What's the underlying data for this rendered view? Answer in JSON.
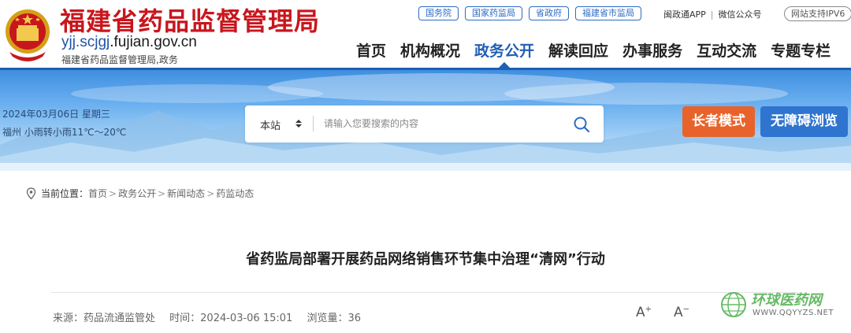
{
  "header": {
    "site_name": "福建省药品监督管理局",
    "domain_prefix": "yjj.scjgj",
    "domain_suffix": ".fujian.gov.cn",
    "subtitle": "福建省药品监督管理局,政务",
    "top_links": [
      "国务院",
      "国家药监局",
      "省政府",
      "福建省市监局"
    ],
    "app_link": "闽政通APP",
    "wechat_link": "微信公众号",
    "ipv6_badge": "网站支持IPV6"
  },
  "nav": {
    "items": [
      "首页",
      "机构概况",
      "政务公开",
      "解读回应",
      "办事服务",
      "互动交流",
      "专题专栏"
    ],
    "active": "政务公开"
  },
  "banner": {
    "date": "2024年03月06日 星期三",
    "weather": "福州 小雨转小雨11℃～20℃",
    "search_scope": "本站",
    "search_placeholder": "请输入您要搜索的内容",
    "elder_mode_label": "长者模式",
    "accessibility_label": "无障碍浏览"
  },
  "breadcrumb": {
    "label": "当前位置：",
    "items": [
      "首页",
      "政务公开",
      "新闻动态",
      "药监动态"
    ]
  },
  "article": {
    "title": "省药监局部署开展药品网络销售环节集中治理“清网”行动",
    "source": "来源：药品流通监管处",
    "time": "时间：2024-03-06 15:01",
    "views": "浏览量：36",
    "font_increase": "A",
    "font_decrease": "A"
  },
  "watermark": {
    "name": "环球医药网",
    "url": "WWW.QQYYZS.NET"
  },
  "colors": {
    "brand_red": "#c8161d",
    "nav_blue": "#1f5fb3",
    "elder_orange": "#e8632b",
    "access_blue": "#2f74cf"
  }
}
